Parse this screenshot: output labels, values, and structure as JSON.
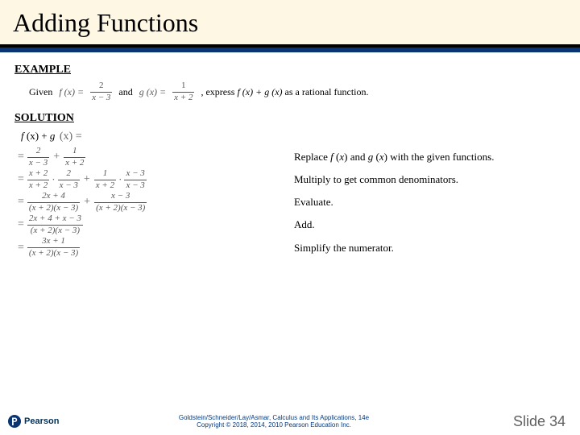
{
  "title": "Adding Functions",
  "example_label": "EXAMPLE",
  "solution_label": "SOLUTION",
  "given": {
    "pre": "Given",
    "f_lhs": "f (x) =",
    "f_num": "2",
    "f_den": "x − 3",
    "connector": "and",
    "g_lhs": "g (x) =",
    "g_num": "1",
    "g_den": "x + 2",
    "post_a": ", express ",
    "post_b": "f (x) + g (x)",
    "post_c": " as a rational function."
  },
  "lead": {
    "a": "f",
    "x1": " (x) + ",
    "b": "g",
    "x2": " (x) ="
  },
  "steps": [
    {
      "explain": "Replace f (x) and g (x) with the given functions.",
      "rendered": [
        {
          "num": "2",
          "den": "x − 3"
        },
        {
          "op": "+"
        },
        {
          "num": "1",
          "den": "x + 2"
        }
      ]
    },
    {
      "explain": "Multiply to get common denominators.",
      "rendered": [
        {
          "num": "x + 2",
          "den": "x + 2"
        },
        {
          "op": "·"
        },
        {
          "num": "2",
          "den": "x − 3"
        },
        {
          "op": "+"
        },
        {
          "num": "1",
          "den": "x + 2"
        },
        {
          "op": "·"
        },
        {
          "num": "x − 3",
          "den": "x − 3"
        }
      ]
    },
    {
      "explain": "Evaluate.",
      "rendered": [
        {
          "num": "2x + 4",
          "den": "(x + 2)(x − 3)"
        },
        {
          "op": "+"
        },
        {
          "num": "x − 3",
          "den": "(x + 2)(x − 3)"
        }
      ]
    },
    {
      "explain": "Add.",
      "rendered": [
        {
          "num": "2x + 4 + x − 3",
          "den": "(x + 2)(x − 3)"
        }
      ]
    },
    {
      "explain": "Simplify the numerator.",
      "rendered": [
        {
          "num": "3x + 1",
          "den": "(x + 2)(x − 3)"
        }
      ]
    }
  ],
  "footer": {
    "brand": "Pearson",
    "credit1": "Goldstein/Schneider/Lay/Asmar, Calculus and Its Applications, 14e",
    "credit2": "Copyright © 2018, 2014, 2010 Pearson Education Inc.",
    "pagelabel": "Slide 34"
  }
}
